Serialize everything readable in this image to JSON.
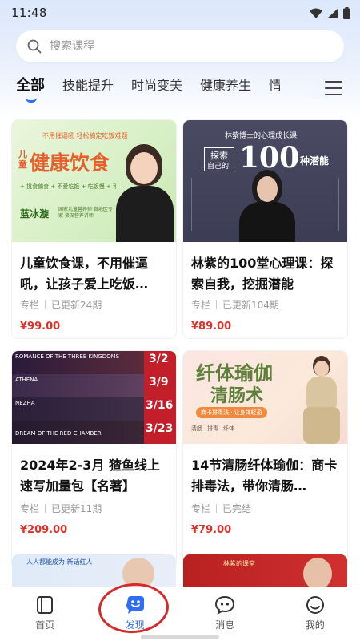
{
  "status_bar": {
    "time": "11:48"
  },
  "search": {
    "placeholder": "搜索课程"
  },
  "tabs": [
    {
      "label": "全部",
      "active": true
    },
    {
      "label": "技能提升"
    },
    {
      "label": "时尚变美"
    },
    {
      "label": "健康养生"
    },
    {
      "label": "情"
    }
  ],
  "cards": [
    {
      "title": "儿童饮食课，不用催逼吼，让孩子爱上吃饭…",
      "type": "专栏",
      "update": "已更新24期",
      "price": "¥99.00",
      "cover": {
        "banner": "不用催逼吼 轻松搞定吃饭难题",
        "headline_small": "儿童",
        "headline": "健康饮食",
        "tags": "+ 挑食偏食 + 不爱吃饭 + 吃饭慢 + 积食",
        "person": "蓝冰漩",
        "person_note": "国家儿童营养师 各地区专家 资深营养讲师"
      }
    },
    {
      "title": "林紫的100堂心理课：探索自我，挖掘潜能",
      "type": "专栏",
      "update": "已更新104期",
      "price": "¥89.00",
      "cover": {
        "top": "林紫博士的心理成长课",
        "left_line1": "探索",
        "left_line2": "自己的",
        "big_number": "100",
        "suffix": "种潜能"
      }
    },
    {
      "title": "2024年2-3月 猹鱼线上速写加量包【名著】",
      "type": "专栏",
      "update": "已更新11期",
      "price": "¥209.00",
      "cover": {
        "rows": [
          "ROMANCE OF THE THREE KINGDOMS",
          "ATHENA",
          "NEZHA",
          "DREAM OF THE RED CHAMBER"
        ],
        "dates": [
          "3/2",
          "3/9",
          "3/16",
          "3/23"
        ]
      }
    },
    {
      "title": "14节清肠纤体瑜伽：商卡排毒法，带你清肠…",
      "type": "专栏",
      "update": "已完结",
      "price": "¥79.00",
      "cover": {
        "headline1": "纤体瑜伽",
        "headline2": "清肠术",
        "sub": "商卡排毒法 · 让身体轻盈",
        "icons": [
          "清肠",
          "排毒",
          "纤体"
        ]
      }
    }
  ],
  "partial_cards": [
    {
      "banner": "人人都能成为 新话红人"
    },
    {
      "banner": "林紫的课堂"
    }
  ],
  "nav": [
    {
      "label": "首页",
      "active": false
    },
    {
      "label": "发现",
      "active": true
    },
    {
      "label": "消息",
      "active": false
    },
    {
      "label": "我的",
      "active": false
    }
  ],
  "colors": {
    "accent": "#2f6df6",
    "price": "#e0302a",
    "annotation": "#d42a2a"
  }
}
